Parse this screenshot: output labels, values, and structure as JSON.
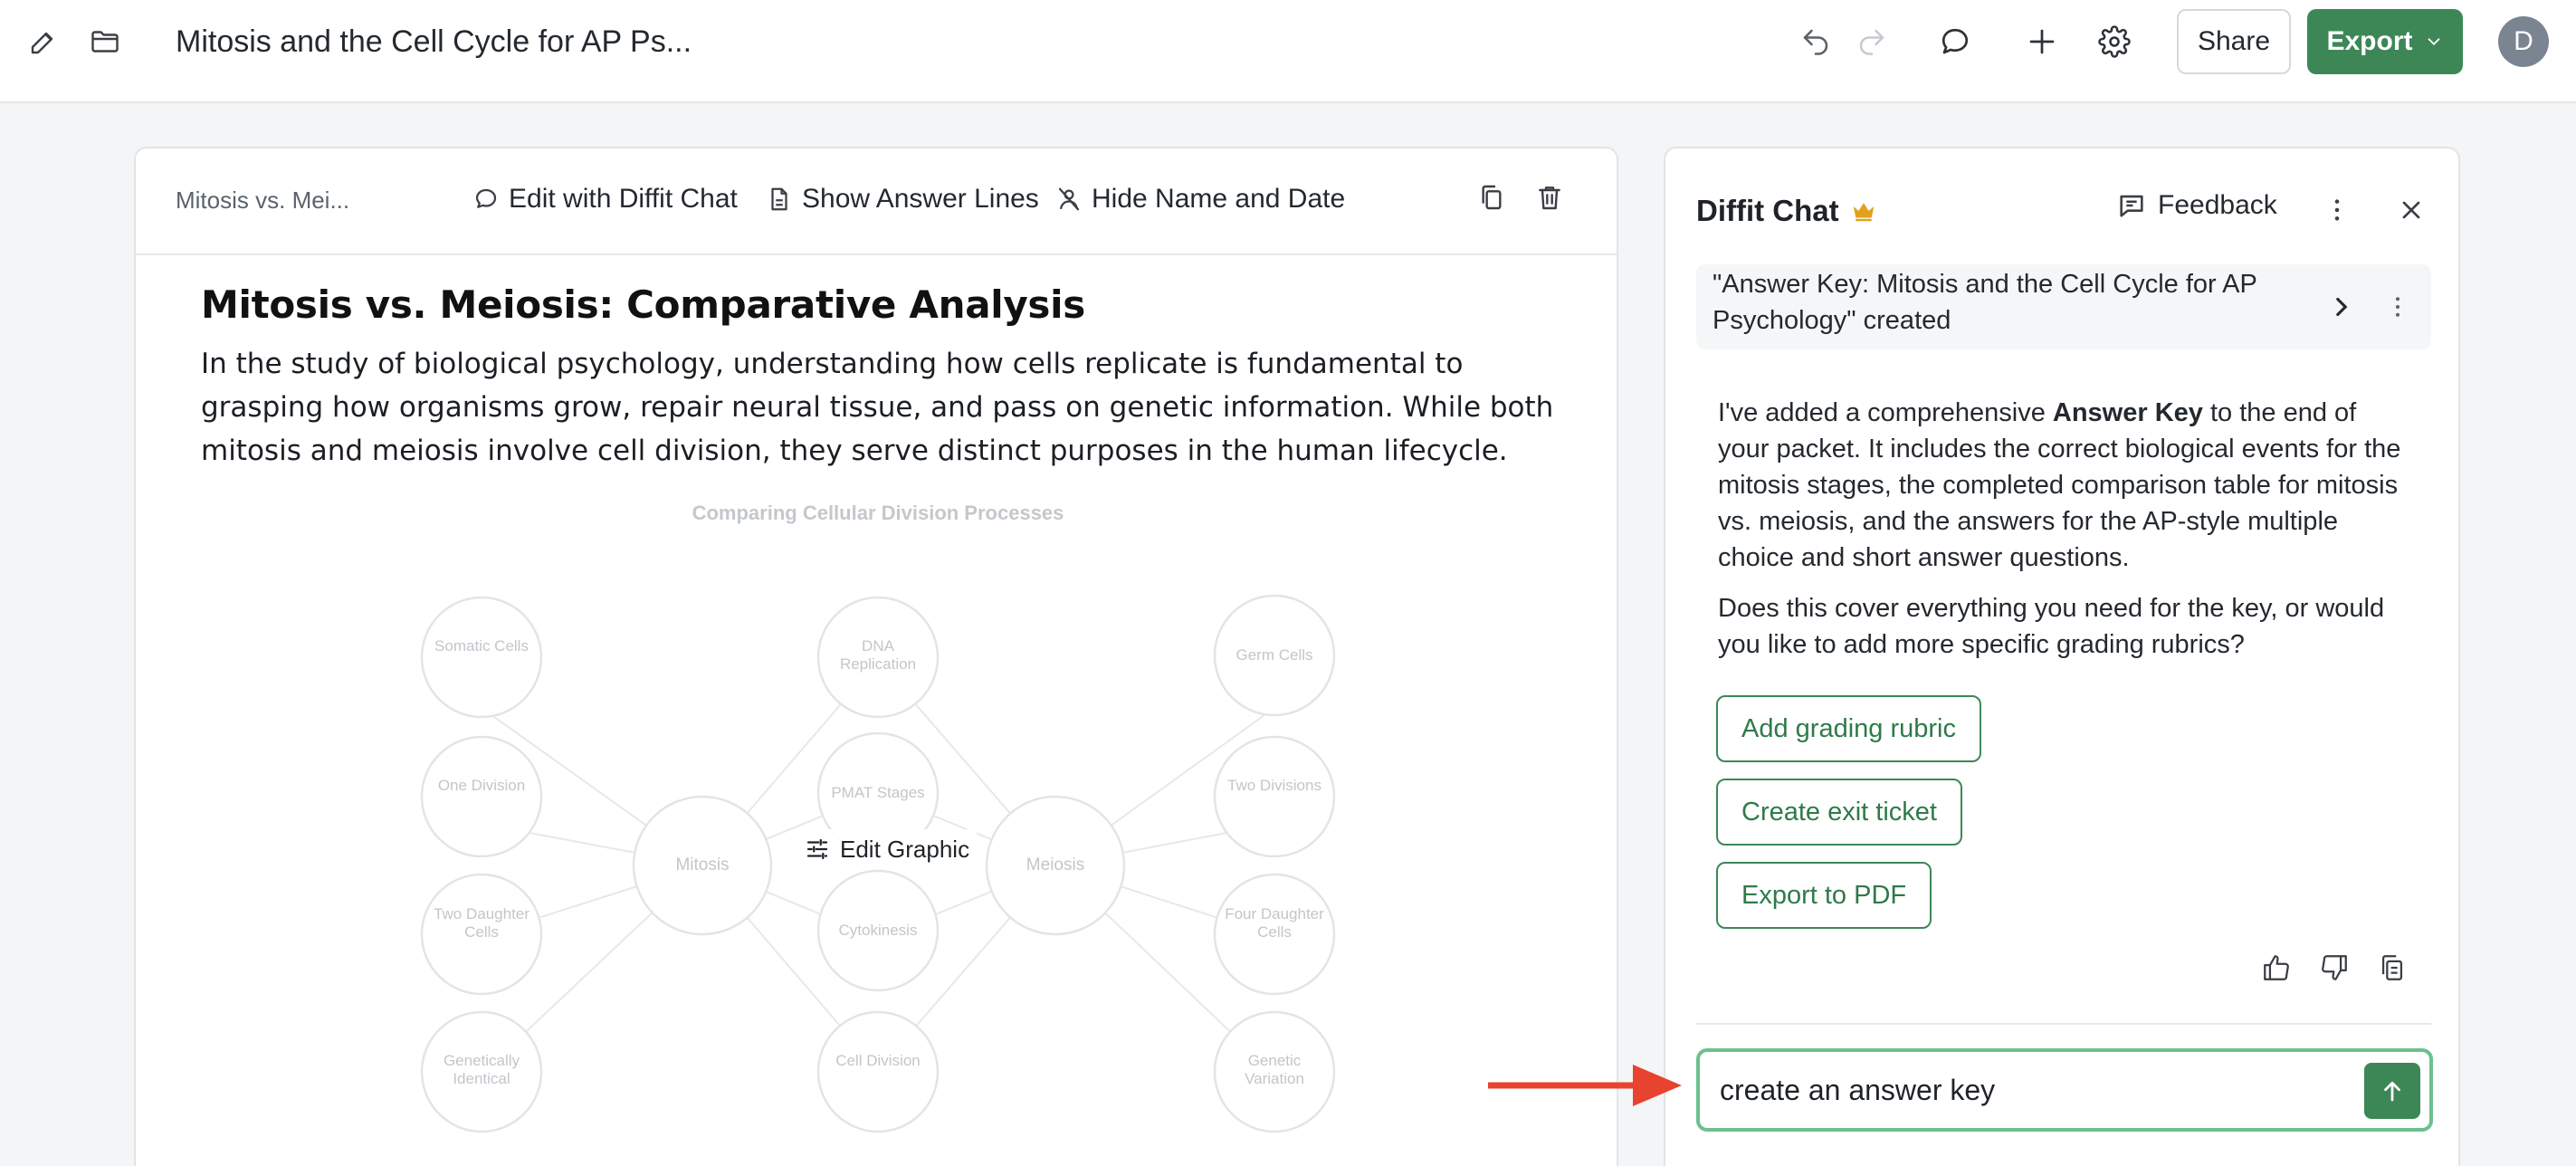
{
  "topbar": {
    "title": "Mitosis and the Cell Cycle for AP Ps...",
    "share_label": "Share",
    "export_label": "Export",
    "avatar_initial": "D",
    "icons": [
      "edit-icon",
      "folder-icon",
      "undo-icon",
      "redo-icon",
      "chat-bubble-icon",
      "plus-icon",
      "gear-icon"
    ]
  },
  "document": {
    "breadcrumb": "Mitosis vs. Mei...",
    "toolbar": {
      "edit_chat": "Edit with Diffit Chat",
      "answer_lines": "Show Answer Lines",
      "hide_name": "Hide Name and Date"
    },
    "heading": "Mitosis vs. Meiosis: Comparative Analysis",
    "paragraph": "In the study of biological psychology, understanding how cells replicate is fundamental to grasping how organisms grow, repair neural tissue, and pass on genetic information. While both mitosis and meiosis involve cell division, they serve distinct purposes in the human lifecycle.",
    "graphic": {
      "title": "Comparing Cellular Division Processes",
      "edit_label": "Edit Graphic",
      "nodes": {
        "somatic": "Somatic Cells",
        "one_division": "One Division",
        "two_daughter": "Two Daughter Cells",
        "genetically_identical": "Genetically Identical",
        "dna_replication": "DNA Replication",
        "pmat": "PMAT Stages",
        "cytokinesis": "Cytokinesis",
        "cell_division": "Cell Division",
        "germ_cells": "Germ Cells",
        "two_divisions": "Two Divisions",
        "four_daughter": "Four Daughter Cells",
        "genetic_variation": "Genetic Variation",
        "mitosis": "Mitosis",
        "meiosis": "Meiosis"
      }
    }
  },
  "chat": {
    "title": "Diffit Chat",
    "feedback_label": "Feedback",
    "created_text": "\"Answer Key: Mitosis and the Cell Cycle for AP Psychology\" created",
    "message": {
      "p1_pre": "I've added a comprehensive ",
      "p1_bold": "Answer Key",
      "p1_post": " to the end of your packet. It includes the correct biological events for the mitosis stages, the completed comparison table for mitosis vs. meiosis, and the answers for the AP-style multiple choice and short answer questions.",
      "p2": "Does this cover everything you need for the key, or would you like to add more specific grading rubrics?"
    },
    "suggestions": [
      "Add grading rubric",
      "Create exit ticket",
      "Export to PDF"
    ],
    "input_value": "create an answer key"
  },
  "colors": {
    "brand_green": "#3d8757",
    "input_border": "#6cc08c",
    "annotation_arrow": "#e8432e",
    "crown": "#e0a21a"
  }
}
